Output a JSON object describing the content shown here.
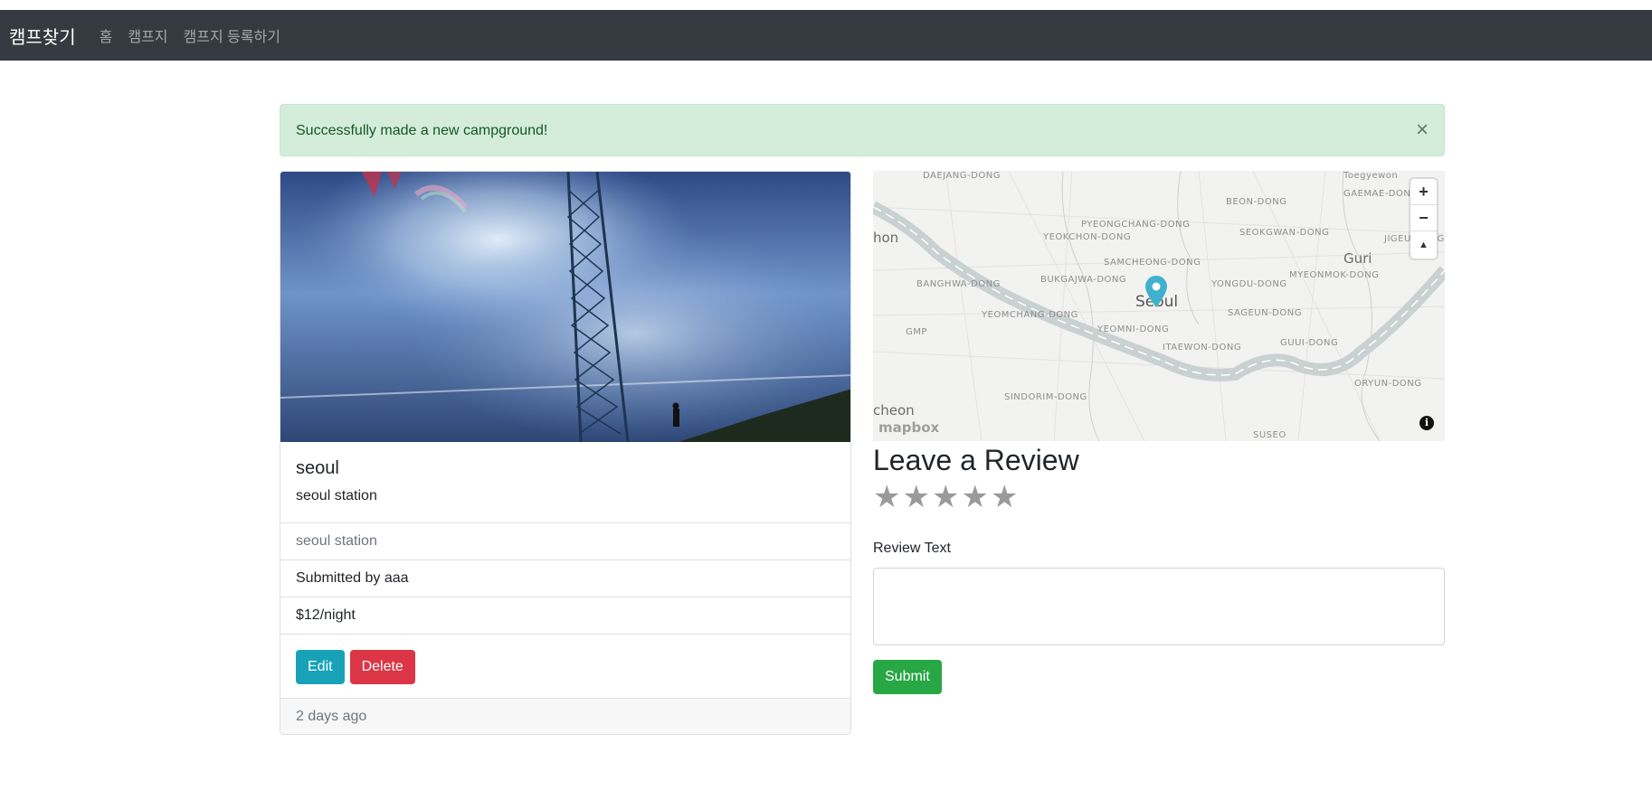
{
  "navbar": {
    "brand": "캠프찾기",
    "links": [
      "홈",
      "캠프지",
      "캠프지 등록하기"
    ]
  },
  "alert": {
    "message": "Successfully made a new campground!",
    "close_glyph": "×"
  },
  "campground": {
    "title": "seoul",
    "description": "seoul station",
    "location": "seoul station",
    "submitted_by": "Submitted by aaa",
    "price": "$12/night",
    "edit_label": "Edit",
    "delete_label": "Delete",
    "posted": "2 days ago"
  },
  "map": {
    "labels": [
      "DAEJANG-DONG",
      "BEON-DONG",
      "GAEMAE-DONG",
      "PYEONGCHANG-DONG",
      "SEOKGWAN-DONG",
      "YEOKCHON-DONG",
      "hon",
      "Guri",
      "SAMCHEONG-DONG",
      "BANGHWA-DONG",
      "BUKGAJWA-DONG",
      "YONGDU-DONG",
      "MYEONMOK-DONG",
      "Seoul",
      "GMP",
      "YEOMCHANG-DONG",
      "SAGEUN-DONG",
      "YEOMNI-DONG",
      "GUUI-DONG",
      "ITAEWON-DONG",
      "SINDORIM-DONG",
      "ORYUN-DONG",
      "cheon",
      "SUSEO",
      "JIGEU-DONG",
      "Toegyewon"
    ],
    "zoom_in": "+",
    "zoom_out": "−",
    "compass": "▲",
    "attribution": "mapbox",
    "info": "i",
    "marker_color": "#3fb1ce"
  },
  "review": {
    "heading": "Leave a Review",
    "stars": [
      "★",
      "★",
      "★",
      "★",
      "★"
    ],
    "rating": 0,
    "text_label": "Review Text",
    "text_value": "",
    "submit_label": "Submit"
  },
  "colors": {
    "navbar": "#343a40",
    "alert_bg": "#d4edda",
    "edit": "#17a2b8",
    "delete": "#dc3545",
    "submit": "#28a745"
  }
}
